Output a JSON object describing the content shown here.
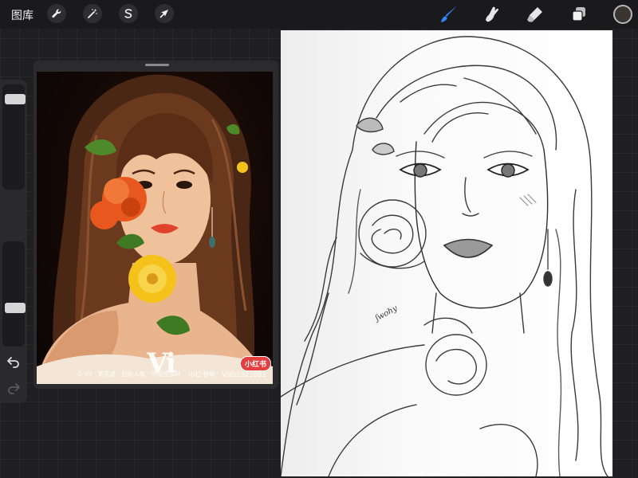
{
  "topbar": {
    "gallery_label": "图库",
    "left_tools": [
      "wrench-icon",
      "magic-wand-icon",
      "selection-s-icon",
      "transform-arrow-icon"
    ],
    "right_tools": [
      "brush-icon",
      "smudge-icon",
      "eraser-icon",
      "layers-icon"
    ],
    "active_tool": "brush",
    "current_color": "#3a3530"
  },
  "sidebar": {
    "brush_size_level": 0.9,
    "opacity_level": 0.35,
    "buttons": [
      "modify-button",
      "undo-icon",
      "redo-icon"
    ]
  },
  "reference": {
    "watermark_logo": "Vi",
    "watermark_badge": "小红书",
    "watermark_caption": "© VII · 繁花语 · 别默人像 · 你值全部好",
    "watermark_code": "小红书号：VIIG2021082",
    "colors": {
      "background": "#0f0806",
      "flower_orange": "#e8581e",
      "flower_yellow": "#f4c21b",
      "leaf": "#4f8a2a"
    }
  },
  "canvas": {
    "signature": "ʃwohy"
  }
}
